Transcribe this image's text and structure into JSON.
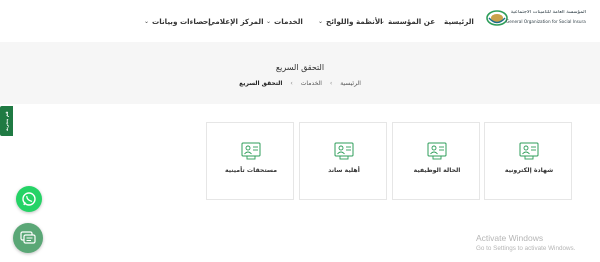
{
  "header": {
    "logo": {
      "name_ar": "المؤسسة العامة للتأمينات الاجتماعية",
      "name_en": "General Organization for Social Insurance"
    },
    "nav": [
      {
        "label": "الرئيسية",
        "has_dropdown": false
      },
      {
        "label": "عن المؤسسة",
        "has_dropdown": true
      },
      {
        "label": "الأنظمة واللوائح",
        "has_dropdown": true
      },
      {
        "label": "الخدمات",
        "has_dropdown": true
      },
      {
        "label": "المركز الإعلامي",
        "has_dropdown": true
      },
      {
        "label": "إحصاءات وبيانات",
        "has_dropdown": true
      }
    ]
  },
  "page": {
    "title": "التحقق السريع",
    "breadcrumb": {
      "home": "الرئيسية",
      "services": "الخدمات",
      "current": "التحقق السريع",
      "separator": "›"
    }
  },
  "side_tab": {
    "label": "قم بتجربة"
  },
  "cards": [
    {
      "label": "شهادة إلكترونية",
      "icon": "certificate-icon"
    },
    {
      "label": "الحالة الوظيفية",
      "icon": "employee-status-icon"
    },
    {
      "label": "أهلية ساند",
      "icon": "saned-eligibility-icon"
    },
    {
      "label": "مستحقات تأمينية",
      "icon": "insurance-dues-icon"
    }
  ],
  "floating": {
    "whatsapp_icon": "whatsapp-icon",
    "chat_icon": "chat-icon"
  },
  "watermark": {
    "title": "Activate Windows",
    "subtitle": "Go to Settings to activate Windows."
  },
  "colors": {
    "brand_green": "#1f7a43",
    "icon_green": "#2e9e5a",
    "whatsapp": "#25d366",
    "chat": "#5aa776",
    "band_bg": "#f6f6f6"
  }
}
